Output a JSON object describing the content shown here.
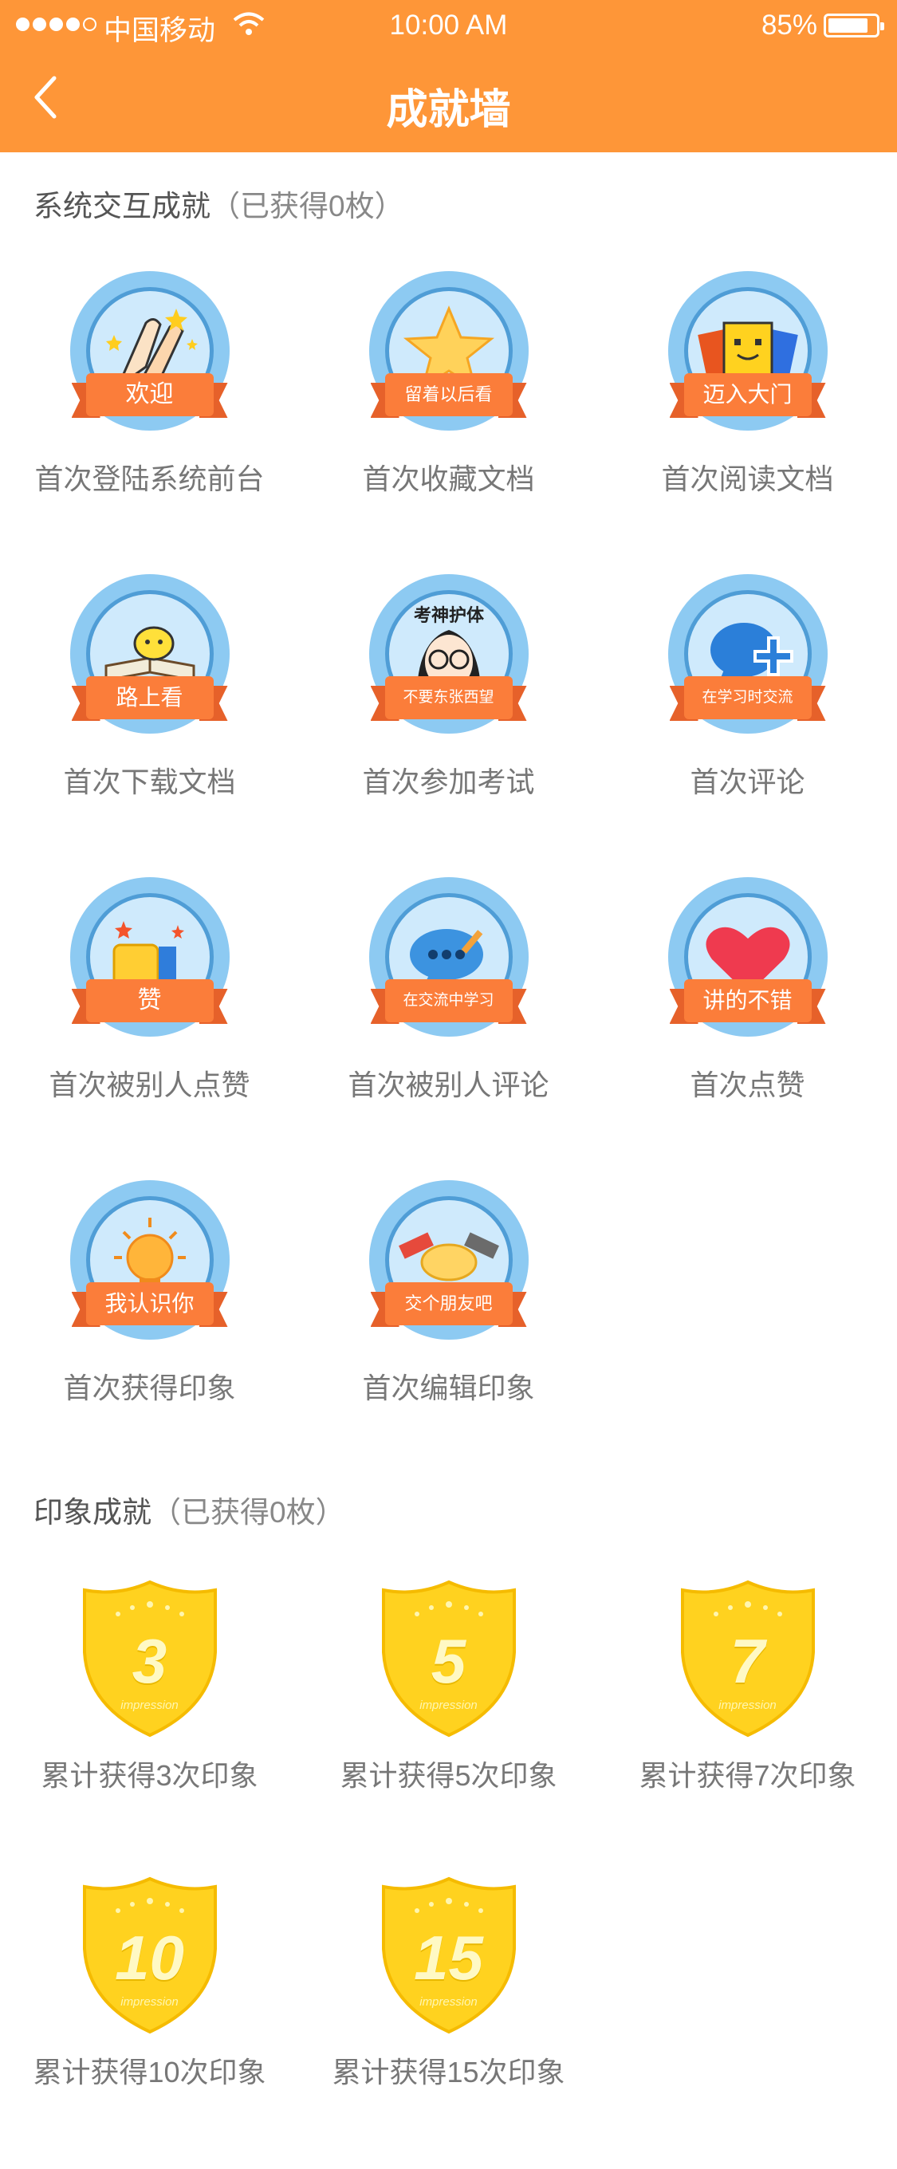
{
  "status_bar": {
    "carrier": "中国移动",
    "time": "10:00 AM",
    "battery": "85%",
    "battery_level": 0.85
  },
  "header": {
    "title": "成就墙",
    "back_icon": "chevron-left-icon"
  },
  "sections": {
    "system": {
      "title": "系统交互成就",
      "count": "（已获得0枚）",
      "badges": [
        {
          "ribbon": "欢迎",
          "label": "首次登陆系统前台",
          "icon": "clapping-hands-icon"
        },
        {
          "ribbon": "留着以后看",
          "label": "首次收藏文档",
          "icon": "star-icon"
        },
        {
          "ribbon": "迈入大门",
          "label": "首次阅读文档",
          "icon": "doorway-icon"
        },
        {
          "ribbon": "路上看",
          "label": "首次下载文档",
          "icon": "book-icon"
        },
        {
          "ribbon": "不要东张西望",
          "label": "首次参加考试",
          "icon": "exam-girl-icon",
          "banner": "考神护体"
        },
        {
          "ribbon": "在学习时交流",
          "label": "首次评论",
          "icon": "comment-plus-icon"
        },
        {
          "ribbon": "赞",
          "label": "首次被别人点赞",
          "icon": "thumbs-up-icon"
        },
        {
          "ribbon": "在交流中学习",
          "label": "首次被别人评论",
          "icon": "speech-bubble-icon"
        },
        {
          "ribbon": "讲的不错",
          "label": "首次点赞",
          "icon": "heart-icon"
        },
        {
          "ribbon": "我认识你",
          "label": "首次获得印象",
          "icon": "lightbulb-icon"
        },
        {
          "ribbon": "交个朋友吧",
          "label": "首次编辑印象",
          "icon": "handshake-icon"
        }
      ]
    },
    "impression": {
      "title": "印象成就",
      "count": "（已获得0枚）",
      "badges": [
        {
          "number": "3",
          "sub": "impression",
          "label": "累计获得3次印象"
        },
        {
          "number": "5",
          "sub": "impression",
          "label": "累计获得5次印象"
        },
        {
          "number": "7",
          "sub": "impression",
          "label": "累计获得7次印象"
        },
        {
          "number": "10",
          "sub": "impression",
          "label": "累计获得10次印象"
        },
        {
          "number": "15",
          "sub": "impression",
          "label": "累计获得15次印象"
        }
      ]
    }
  },
  "colors": {
    "header": "#fe9638",
    "ribbon": "#fb7d3a",
    "medal_ring": "#8dcaf2",
    "shield": "#ffd21f"
  }
}
